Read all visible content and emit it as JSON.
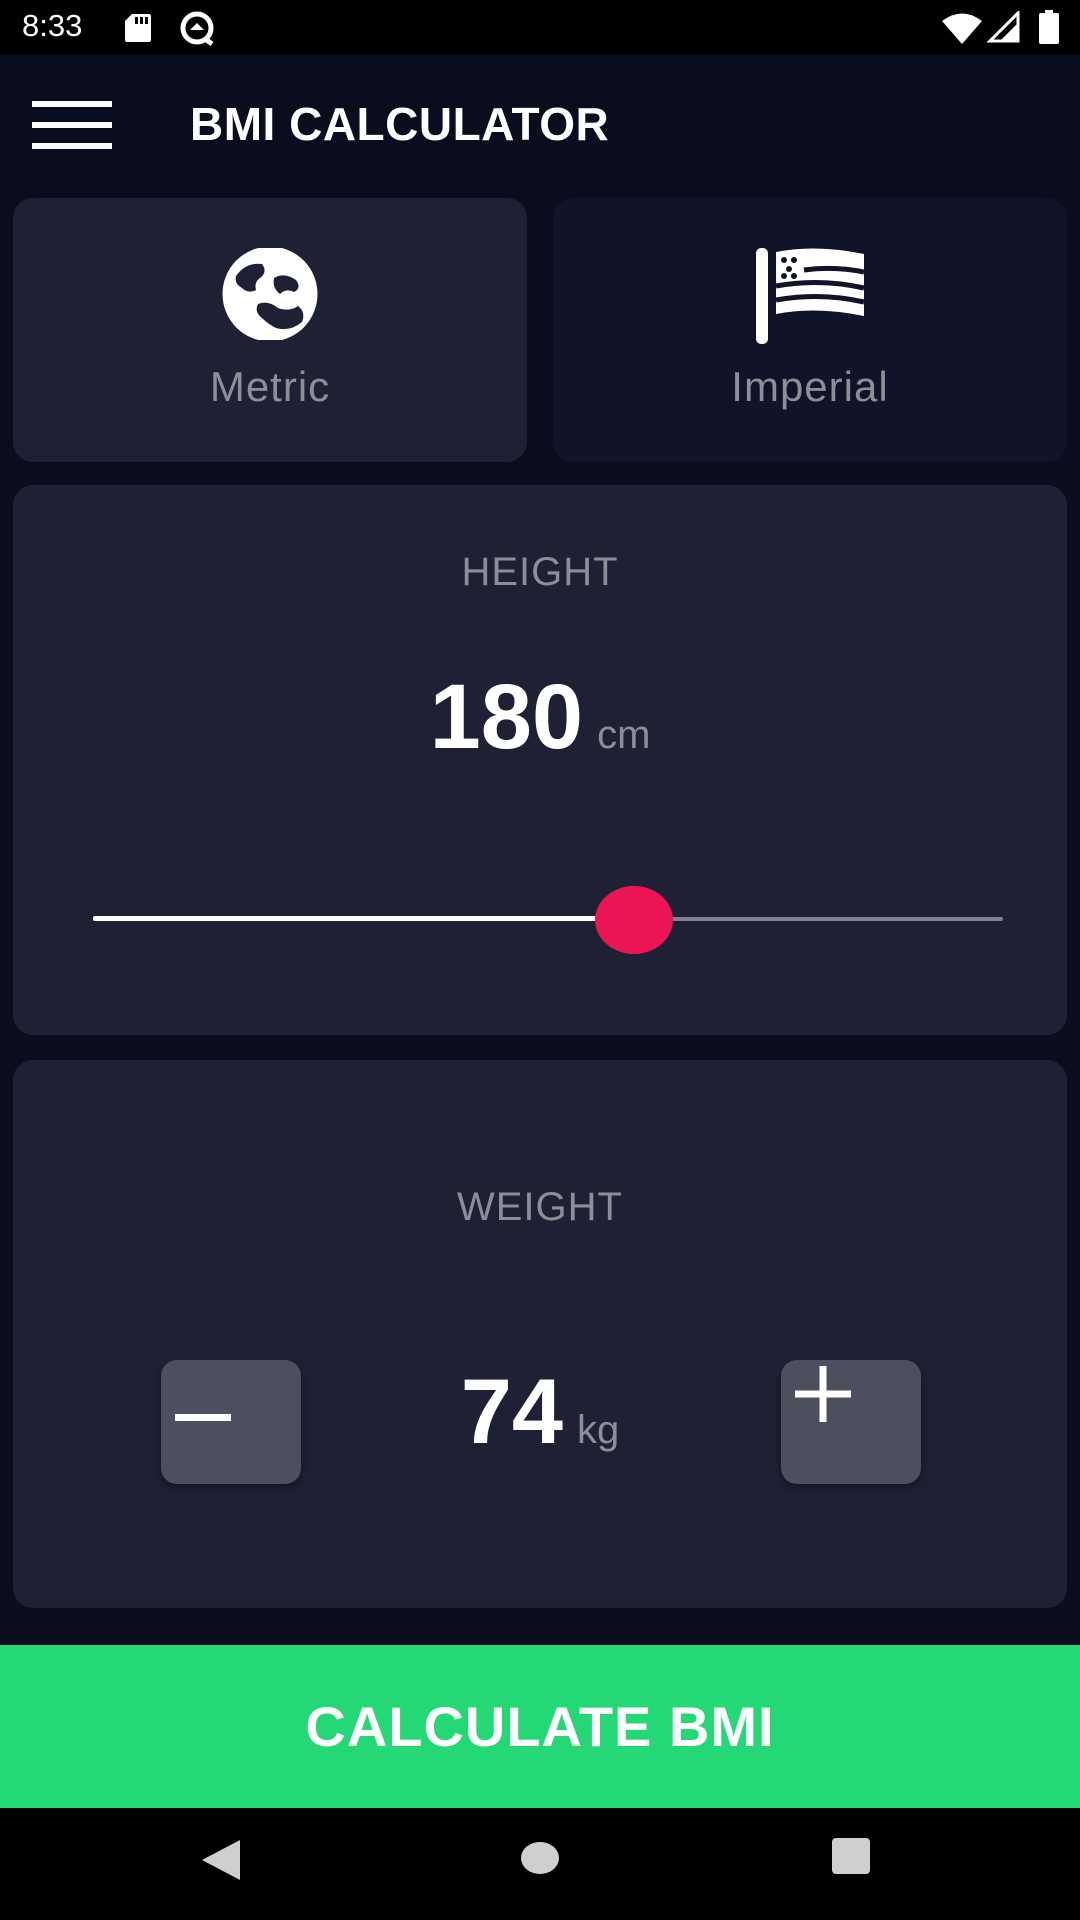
{
  "status_bar": {
    "time": "8:33",
    "icons": [
      "sd-card-icon",
      "sync-icon",
      "wifi-icon",
      "signal-icon",
      "battery-icon"
    ]
  },
  "app_bar": {
    "title": "BMI CALCULATOR",
    "menu_icon": "hamburger-menu-icon"
  },
  "units": {
    "selected": "metric",
    "metric": {
      "label": "Metric",
      "icon": "globe-icon"
    },
    "imperial": {
      "label": "Imperial",
      "icon": "flag-icon"
    }
  },
  "height": {
    "title": "HEIGHT",
    "value": "180",
    "unit": "cm",
    "slider_fraction": 0.595
  },
  "weight": {
    "title": "WEIGHT",
    "value": "74",
    "unit": "kg",
    "decrement_icon": "minus-icon",
    "increment_icon": "plus-icon"
  },
  "calculate_button": {
    "label": "CALCULATE BMI"
  },
  "nav_bar": {
    "icons": [
      "back-icon",
      "home-icon",
      "recents-icon"
    ]
  },
  "colors": {
    "background": "#0a0d1e",
    "card_active": "#1e2034",
    "card_inactive": "#111328",
    "label_gray": "#8d8e98",
    "accent_pink": "#eb1555",
    "button_green": "#24d876",
    "step_button": "#4c4f5e"
  }
}
